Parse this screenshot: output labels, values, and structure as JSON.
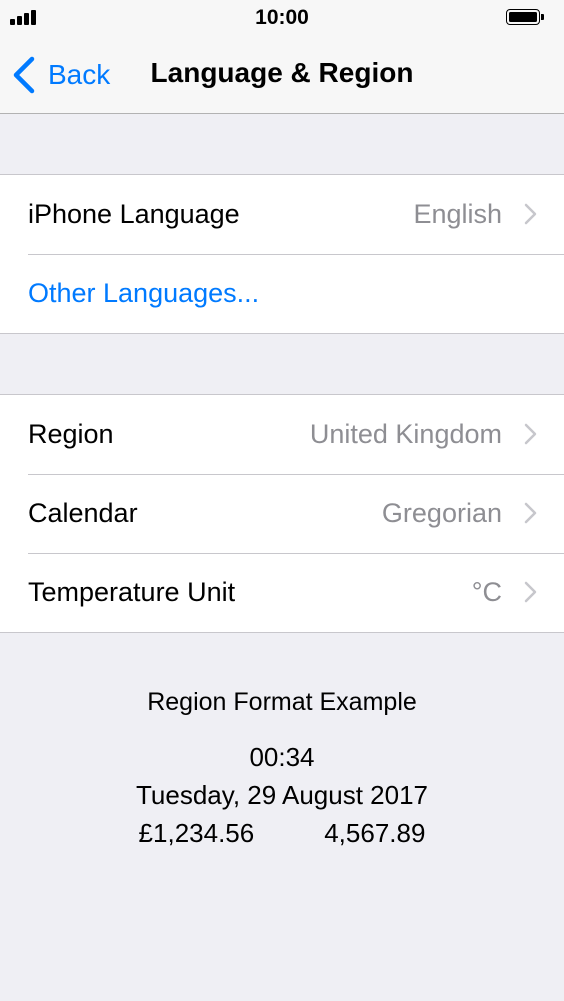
{
  "status_bar": {
    "time": "10:00",
    "signal_icon": "signal-bars-icon",
    "battery_icon": "battery-full-icon"
  },
  "nav": {
    "back_label": "Back",
    "title": "Language & Region",
    "back_icon": "chevron-left-icon"
  },
  "language_group": {
    "rows": [
      {
        "label": "iPhone Language",
        "value": "English",
        "disclosure": true
      },
      {
        "label": "Other Languages...",
        "link": true
      }
    ]
  },
  "region_group": {
    "rows": [
      {
        "label": "Region",
        "value": "United Kingdom",
        "disclosure": true
      },
      {
        "label": "Calendar",
        "value": "Gregorian",
        "disclosure": true
      },
      {
        "label": "Temperature Unit",
        "value": "°C",
        "disclosure": true
      }
    ]
  },
  "format_example": {
    "heading": "Region Format Example",
    "time": "00:34",
    "date": "Tuesday, 29 August 2017",
    "currency": "£1,234.56",
    "number": "4,567.89"
  },
  "colors": {
    "accent": "#007aff",
    "background": "#efeff4",
    "secondary_text": "#8e8e93",
    "separator": "#c8c7cc"
  }
}
